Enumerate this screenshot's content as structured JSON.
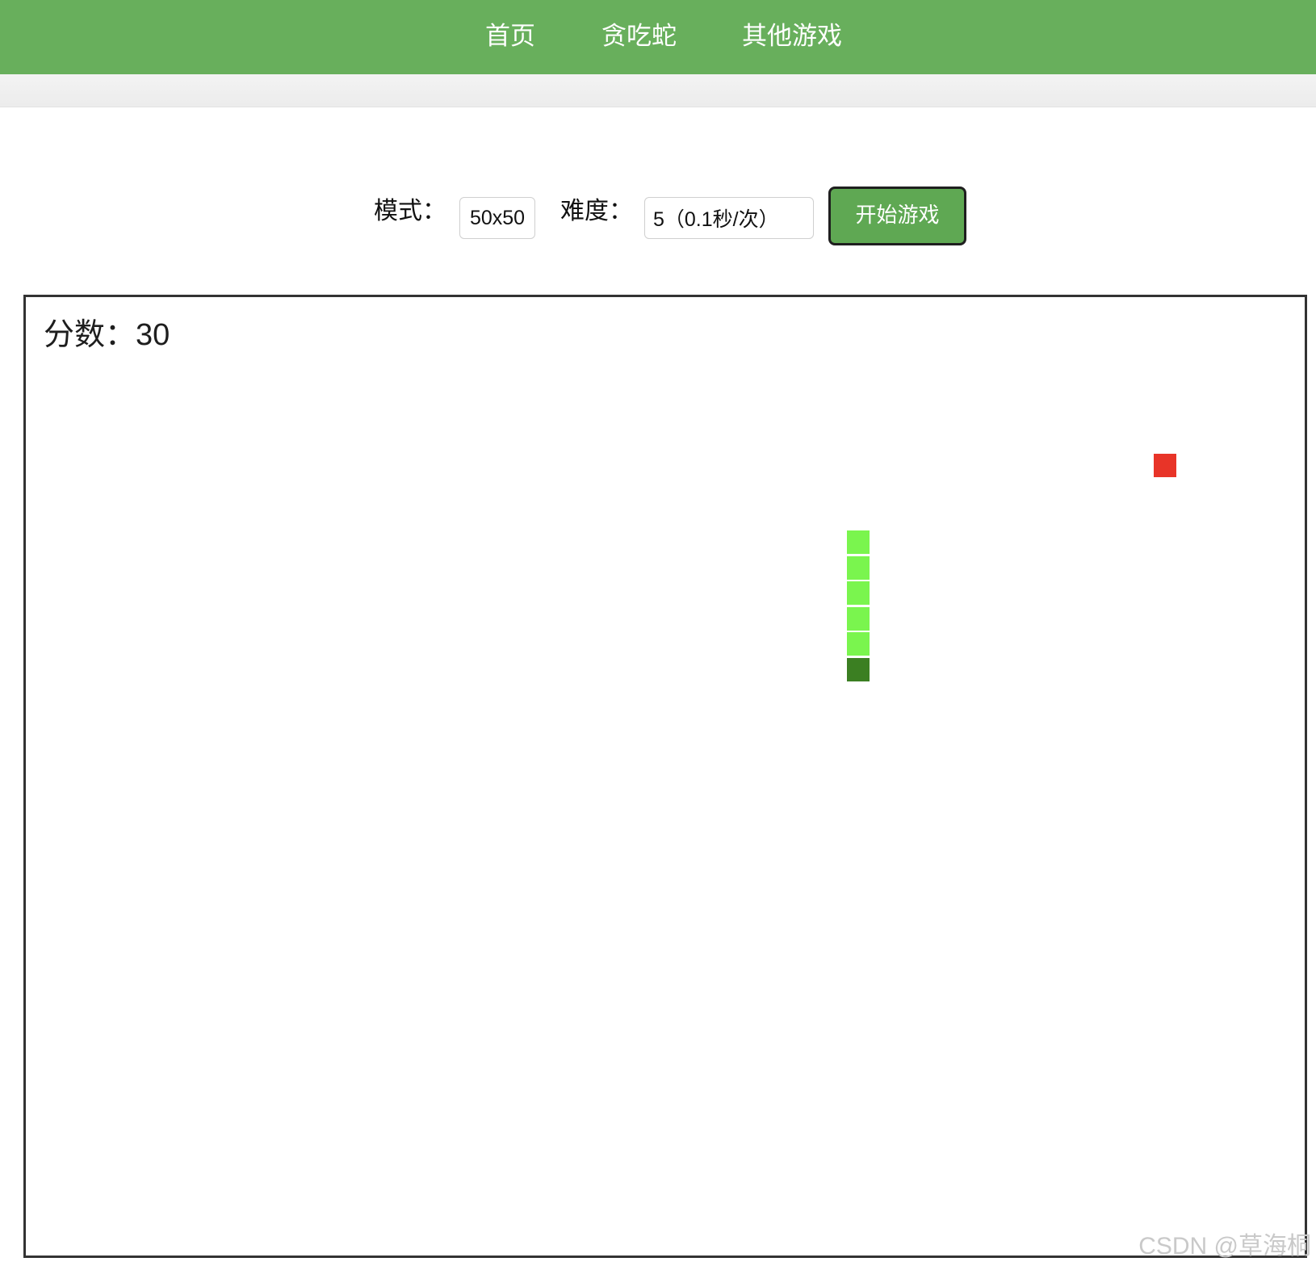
{
  "nav": {
    "items": [
      {
        "label": "首页"
      },
      {
        "label": "贪吃蛇"
      },
      {
        "label": "其他游戏"
      }
    ]
  },
  "controls": {
    "mode_label": "模式：",
    "mode_value": "50x50",
    "difficulty_label": "难度：",
    "difficulty_value": "5（0.1秒/次）",
    "start_label": "开始游戏"
  },
  "game": {
    "score_label": "分数：",
    "score_value": "30",
    "grid_size": 50,
    "snake": {
      "head_color": "#3b7f22",
      "body_color": "#7af54e",
      "segments": [
        {
          "col": 32,
          "row": 14
        },
        {
          "col": 32,
          "row": 13
        },
        {
          "col": 32,
          "row": 12
        },
        {
          "col": 32,
          "row": 11
        },
        {
          "col": 32,
          "row": 10
        },
        {
          "col": 32,
          "row": 9
        }
      ]
    },
    "food": {
      "col": 44,
      "row": 6,
      "color": "#e83428"
    }
  },
  "colors": {
    "nav_background": "#68af5c",
    "button_background": "#5fa853"
  },
  "watermark": "CSDN @草海桐"
}
